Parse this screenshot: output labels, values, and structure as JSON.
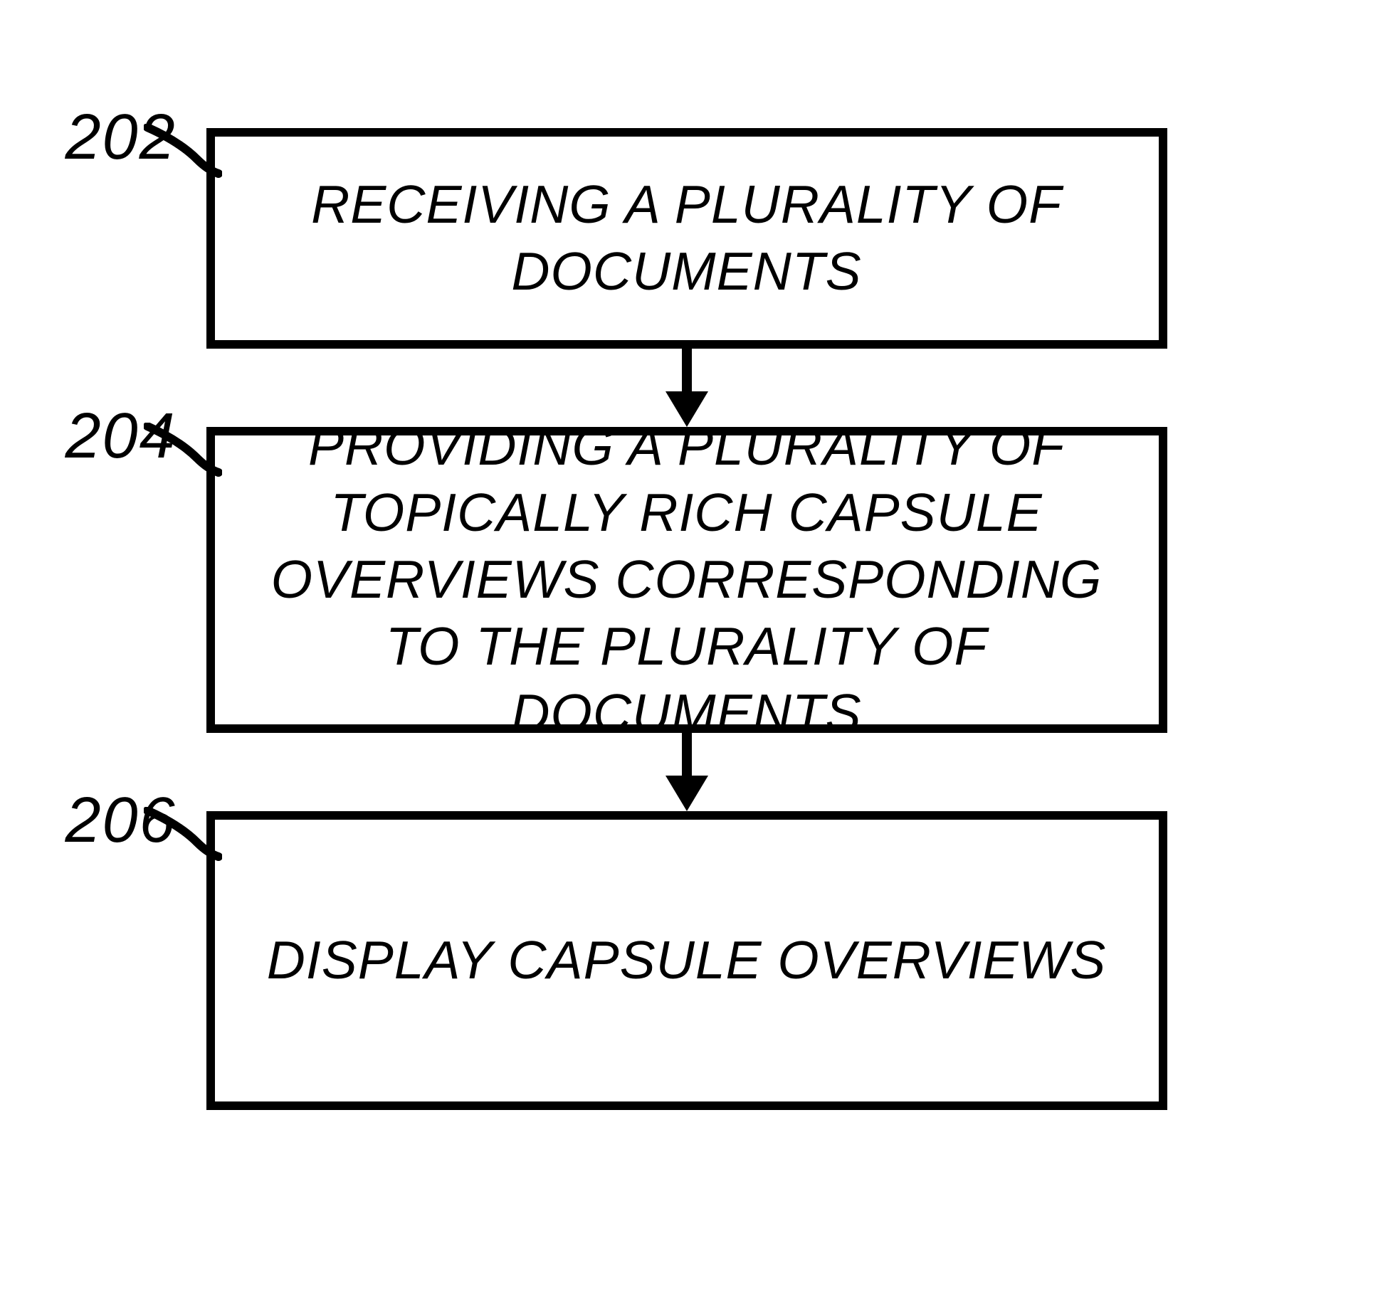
{
  "flowchart": {
    "steps": [
      {
        "ref": "202",
        "text": "RECEIVING A PLURALITY OF DOCUMENTS"
      },
      {
        "ref": "204",
        "text": "PROVIDING A PLURALITY OF TOPICALLY RICH CAPSULE OVERVIEWS CORRESPONDING TO THE PLURALITY OF DOCUMENTS"
      },
      {
        "ref": "206",
        "text": "DISPLAY CAPSULE OVERVIEWS"
      }
    ]
  }
}
